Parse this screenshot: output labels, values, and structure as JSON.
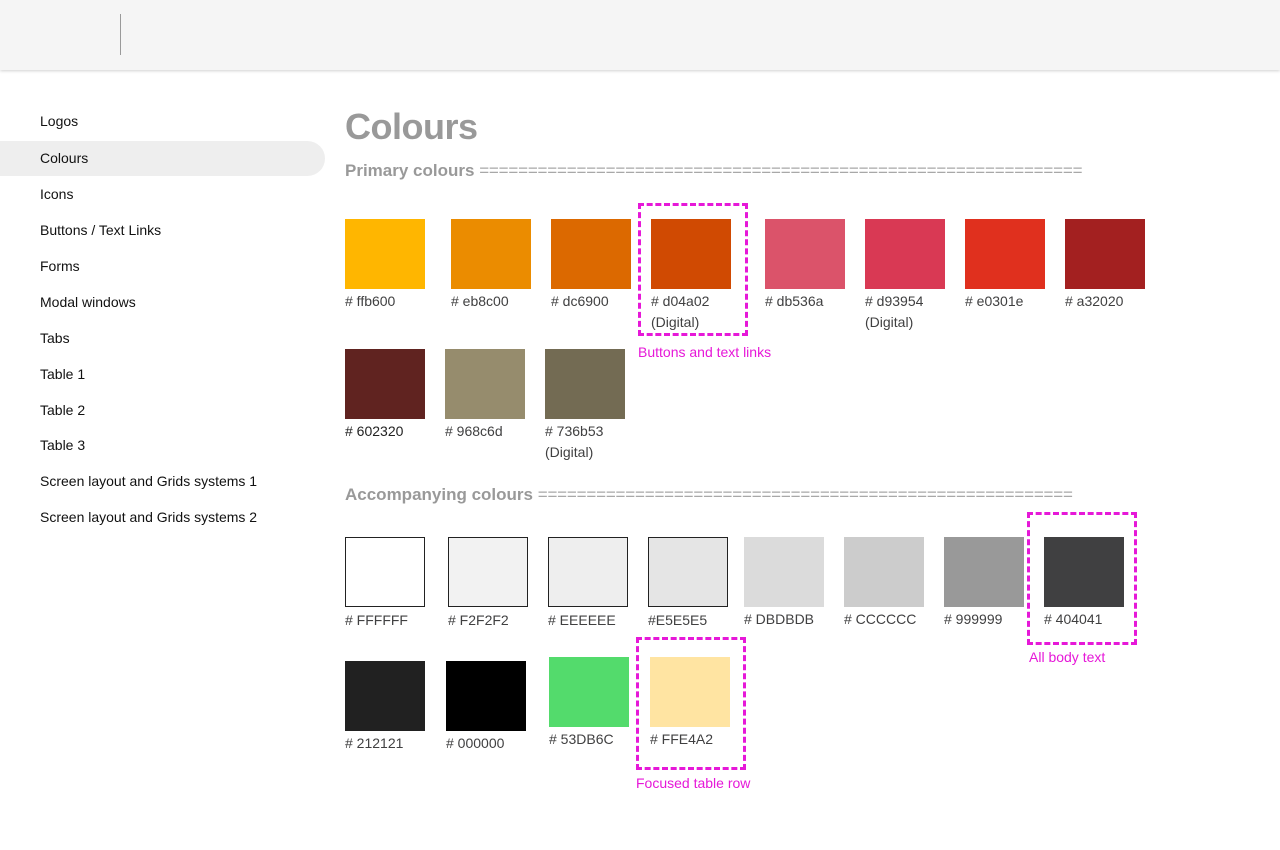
{
  "sidebar": {
    "items": [
      {
        "label": "Logos",
        "active": false
      },
      {
        "label": "Colours",
        "active": true
      },
      {
        "label": "Icons",
        "active": false
      },
      {
        "label": "Buttons / Text Links",
        "active": false
      },
      {
        "label": "Forms",
        "active": false
      },
      {
        "label": "Modal windows",
        "active": false
      },
      {
        "label": "Tabs",
        "active": false
      },
      {
        "label": "Table 1",
        "active": false
      },
      {
        "label": "Table 2",
        "active": false
      },
      {
        "label": "Table 3",
        "active": false
      },
      {
        "label": "Screen layout and Grids systems 1",
        "active": false
      },
      {
        "label": "Screen layout and Grids systems 2",
        "active": false
      }
    ]
  },
  "main": {
    "title": "Colours",
    "primary": {
      "heading": "Primary colours",
      "rule": "==============================================================",
      "swatches": [
        {
          "color": "#ffb600",
          "label": "# ffb600"
        },
        {
          "color": "#eb8c00",
          "label": "# eb8c00"
        },
        {
          "color": "#dc6900",
          "label": "# dc6900"
        },
        {
          "color": "#d04a02",
          "label": "# d04a02",
          "note": "(Digital)"
        },
        {
          "color": "#db536a",
          "label": "# db536a"
        },
        {
          "color": "#d93954",
          "label": "# d93954",
          "note": "(Digital)"
        },
        {
          "color": "#e0301e",
          "label": "# e0301e"
        },
        {
          "color": "#a32020",
          "label": "# a32020"
        },
        {
          "color": "#602320",
          "label": "# 602320"
        },
        {
          "color": "#968c6d",
          "label": "# 968c6d"
        },
        {
          "color": "#736b53",
          "label": "# 736b53",
          "note": "(Digital)"
        }
      ]
    },
    "accompanying": {
      "heading": "Accompanying colours",
      "rule": "=======================================================",
      "swatches": [
        {
          "color": "#FFFFFF",
          "label": "# FFFFFF"
        },
        {
          "color": "#F2F2F2",
          "label": "# F2F2F2"
        },
        {
          "color": "#EEEEEE",
          "label": "# EEEEEE"
        },
        {
          "color": "#E5E5E5",
          "label": "#E5E5E5"
        },
        {
          "color": "#DBDBDB",
          "label": "# DBDBDB"
        },
        {
          "color": "#CCCCCC",
          "label": "# CCCCCC"
        },
        {
          "color": "#999999",
          "label": "# 999999"
        },
        {
          "color": "#404041",
          "label": "# 404041"
        },
        {
          "color": "#212121",
          "label": "# 212121"
        },
        {
          "color": "#000000",
          "label": "# 000000"
        },
        {
          "color": "#53DB6C",
          "label": "# 53DB6C"
        },
        {
          "color": "#FFE4A2",
          "label": "# FFE4A2"
        }
      ]
    },
    "annotations": {
      "buttons": "Buttons and text links",
      "body_text": "All body text",
      "focused_row": "Focused table row",
      "highlight_color": "#e618d8"
    }
  }
}
